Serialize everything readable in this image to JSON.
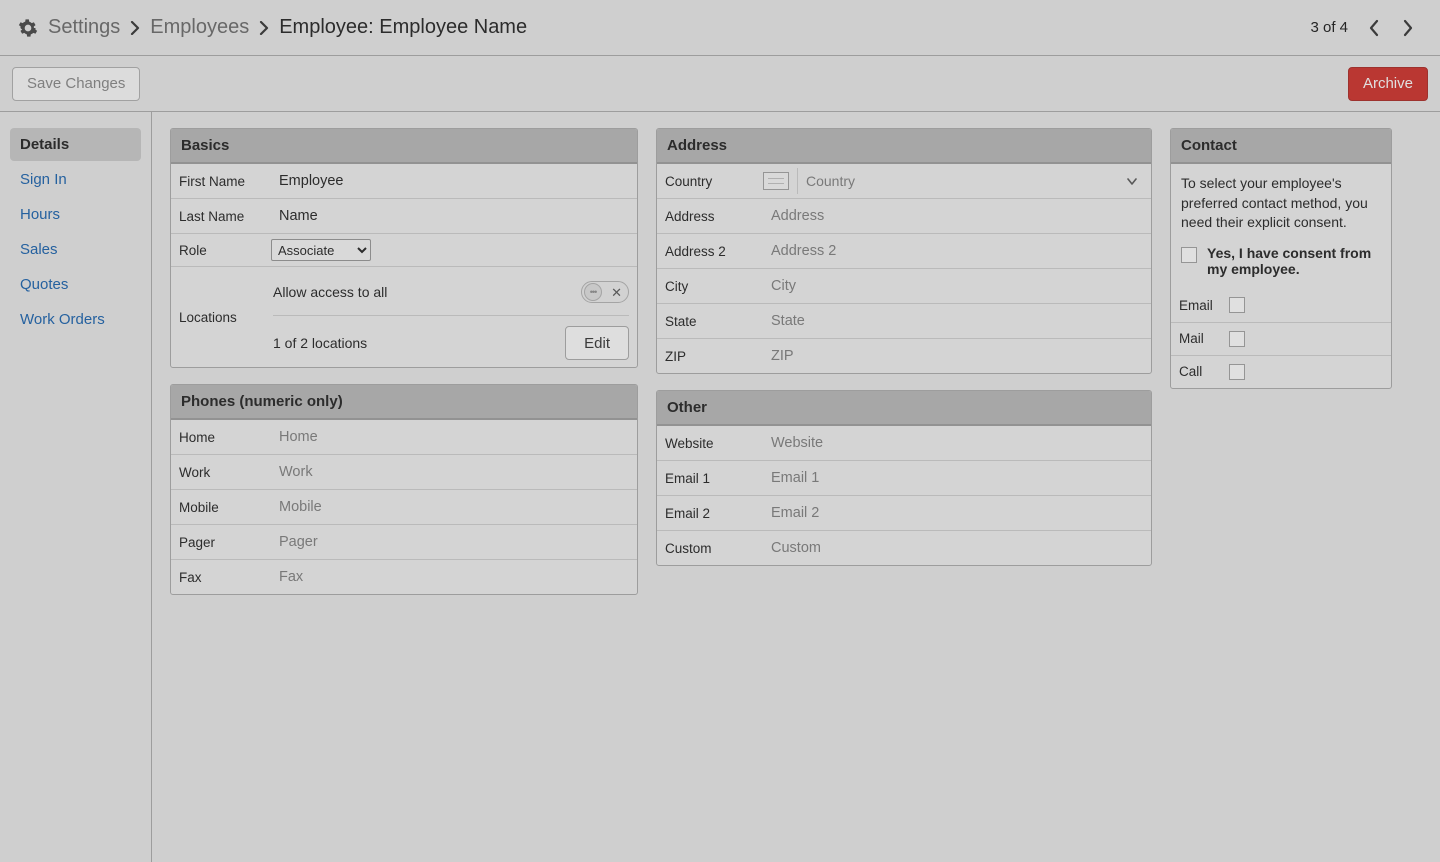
{
  "breadcrumb": {
    "settings": "Settings",
    "employees": "Employees",
    "current": "Employee: Employee Name"
  },
  "pager": {
    "text": "3 of 4"
  },
  "actions": {
    "save": "Save Changes",
    "archive": "Archive"
  },
  "sidebar": {
    "items": [
      {
        "label": "Details",
        "active": true
      },
      {
        "label": "Sign In"
      },
      {
        "label": "Hours"
      },
      {
        "label": "Sales"
      },
      {
        "label": "Quotes"
      },
      {
        "label": "Work Orders"
      }
    ]
  },
  "basics": {
    "title": "Basics",
    "first_name_label": "First Name",
    "first_name_value": "Employee",
    "last_name_label": "Last Name",
    "last_name_value": "Name",
    "role_label": "Role",
    "role_value": "Associate",
    "locations_label": "Locations",
    "allow_access_label": "Allow access to all",
    "allow_access": false,
    "locations_summary": "1 of 2 locations",
    "edit_label": "Edit"
  },
  "phones": {
    "title": "Phones (numeric only)",
    "rows": [
      {
        "label": "Home",
        "placeholder": "Home",
        "value": ""
      },
      {
        "label": "Work",
        "placeholder": "Work",
        "value": ""
      },
      {
        "label": "Mobile",
        "placeholder": "Mobile",
        "value": ""
      },
      {
        "label": "Pager",
        "placeholder": "Pager",
        "value": ""
      },
      {
        "label": "Fax",
        "placeholder": "Fax",
        "value": ""
      }
    ]
  },
  "address": {
    "title": "Address",
    "country_label": "Country",
    "country_placeholder": "Country",
    "rows": [
      {
        "label": "Address",
        "placeholder": "Address"
      },
      {
        "label": "Address 2",
        "placeholder": "Address 2"
      },
      {
        "label": "City",
        "placeholder": "City"
      },
      {
        "label": "State",
        "placeholder": "State"
      },
      {
        "label": "ZIP",
        "placeholder": "ZIP"
      }
    ]
  },
  "other": {
    "title": "Other",
    "rows": [
      {
        "label": "Website",
        "placeholder": "Website"
      },
      {
        "label": "Email 1",
        "placeholder": "Email 1"
      },
      {
        "label": "Email 2",
        "placeholder": "Email 2"
      },
      {
        "label": "Custom",
        "placeholder": "Custom"
      }
    ]
  },
  "contact": {
    "title": "Contact",
    "blurb": "To select your employee's preferred contact method, you need their explicit consent.",
    "consent_label": "Yes, I have consent from my employee.",
    "methods": [
      {
        "label": "Email"
      },
      {
        "label": "Mail"
      },
      {
        "label": "Call"
      }
    ]
  }
}
